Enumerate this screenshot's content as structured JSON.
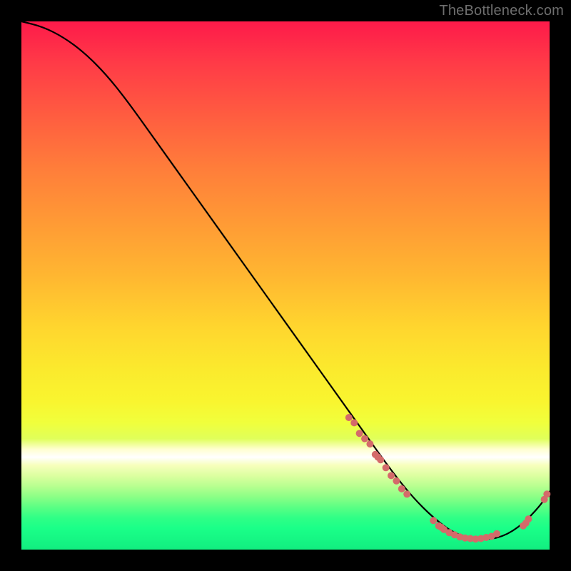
{
  "watermark": "TheBottleneck.com",
  "chart_data": {
    "type": "line",
    "title": "",
    "xlabel": "",
    "ylabel": "",
    "xlim": [
      0,
      100
    ],
    "ylim": [
      0,
      100
    ],
    "grid": false,
    "legend": false,
    "series": [
      {
        "name": "curve",
        "x": [
          0,
          4,
          8,
          12,
          16,
          20,
          25,
          30,
          35,
          40,
          45,
          50,
          55,
          60,
          65,
          70,
          74,
          78,
          82,
          86,
          90,
          94,
          98,
          100
        ],
        "y": [
          100,
          99,
          97,
          94,
          90,
          85,
          78,
          71,
          64,
          57,
          50,
          43,
          36,
          29,
          22,
          15,
          10,
          6,
          3,
          2,
          2,
          4,
          8,
          11
        ]
      }
    ],
    "points": [
      {
        "name": "cluster-left-region",
        "xy": [
          [
            62,
            25
          ],
          [
            63,
            24
          ],
          [
            64,
            22
          ],
          [
            65,
            21
          ],
          [
            66,
            20
          ],
          [
            67,
            18
          ],
          [
            67.5,
            17.5
          ],
          [
            68,
            17
          ],
          [
            69,
            15.5
          ],
          [
            70,
            14
          ],
          [
            71,
            13
          ],
          [
            72,
            11.5
          ],
          [
            73,
            10.5
          ]
        ]
      },
      {
        "name": "cluster-valley-floor",
        "xy": [
          [
            78,
            5.5
          ],
          [
            79,
            4.5
          ],
          [
            79.5,
            4.2
          ],
          [
            80,
            3.8
          ],
          [
            81,
            3.2
          ],
          [
            82,
            2.8
          ],
          [
            83,
            2.4
          ],
          [
            84,
            2.2
          ],
          [
            85,
            2.1
          ],
          [
            86,
            2.0
          ],
          [
            87,
            2.1
          ],
          [
            88,
            2.3
          ],
          [
            89,
            2.5
          ],
          [
            90,
            3.0
          ]
        ]
      },
      {
        "name": "cluster-right-rise",
        "xy": [
          [
            95,
            4.5
          ],
          [
            95.5,
            5.0
          ],
          [
            96,
            5.8
          ],
          [
            99,
            9.5
          ],
          [
            99.5,
            10.5
          ]
        ]
      }
    ]
  }
}
